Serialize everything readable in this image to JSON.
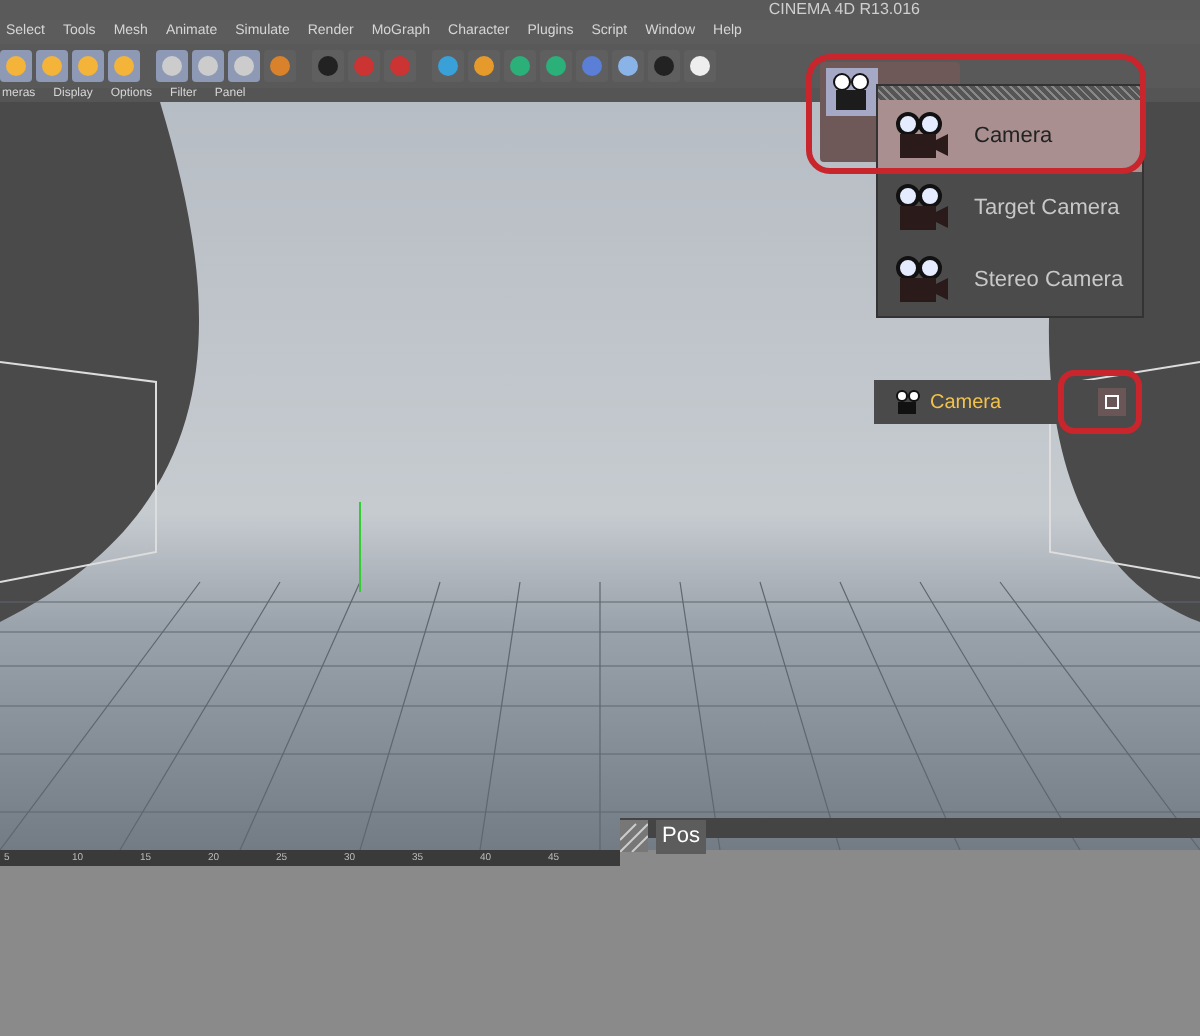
{
  "window": {
    "title": "CINEMA 4D R13.016"
  },
  "menu": [
    "Select",
    "Tools",
    "Mesh",
    "Animate",
    "Simulate",
    "Render",
    "MoGraph",
    "Character",
    "Plugins",
    "Script",
    "Window",
    "Help"
  ],
  "viewport_menu": [
    "meras",
    "Display",
    "Options",
    "Filter",
    "Panel"
  ],
  "camera_menu": {
    "items": [
      {
        "label": "Camera",
        "selected": true
      },
      {
        "label": "Target Camera",
        "selected": false
      },
      {
        "label": "Stereo Camera",
        "selected": false
      }
    ]
  },
  "object_manager": {
    "object": "Camera"
  },
  "timeline": {
    "ticks": [
      "5",
      "10",
      "15",
      "20",
      "25",
      "30",
      "35",
      "40",
      "45"
    ]
  },
  "attribute_panel": {
    "tab": "Pos"
  }
}
